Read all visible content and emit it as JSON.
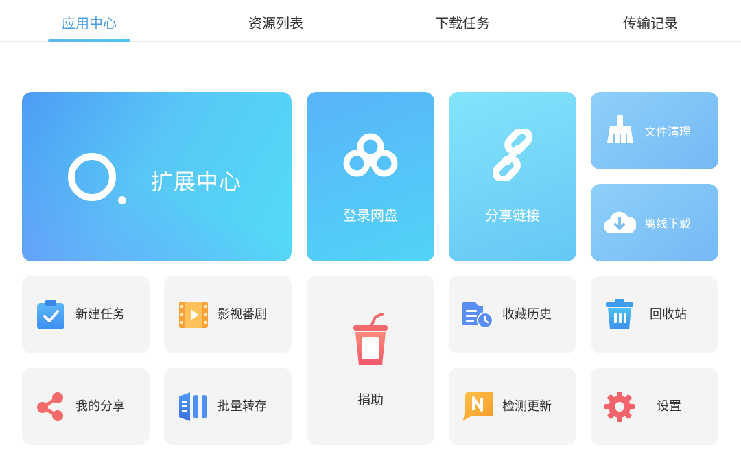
{
  "tabs": [
    {
      "label": "应用中心",
      "active": true
    },
    {
      "label": "资源列表",
      "active": false
    },
    {
      "label": "下载任务",
      "active": false
    },
    {
      "label": "传输记录",
      "active": false
    }
  ],
  "tiles": {
    "extension_center": "扩展中心",
    "login_netdisk": "登录网盘",
    "share_link": "分享链接",
    "file_cleanup": "文件清理",
    "offline_download": "离线下载",
    "new_task": "新建任务",
    "video_series": "影视番剧",
    "donate": "捐助",
    "favorites_history": "收藏历史",
    "recycle_bin": "回收站",
    "my_share": "我的分享",
    "batch_save": "批量转存",
    "check_update": "检测更新",
    "settings": "设置"
  },
  "icons": {
    "extension_center": "search-ring-icon",
    "login_netdisk": "cloud-icon",
    "share_link": "link-icon",
    "file_cleanup": "broom-icon",
    "offline_download": "cloud-download-icon",
    "new_task": "clipboard-check-icon",
    "video_series": "film-icon",
    "donate": "drink-cup-icon",
    "favorites_history": "history-file-icon",
    "recycle_bin": "trash-icon",
    "my_share": "share-icon",
    "batch_save": "batch-icon",
    "check_update": "update-icon",
    "settings": "gear-icon"
  },
  "colors": {
    "accent": "#4a9fe8",
    "tile_gray": "#f4f4f4",
    "text": "#333333"
  }
}
